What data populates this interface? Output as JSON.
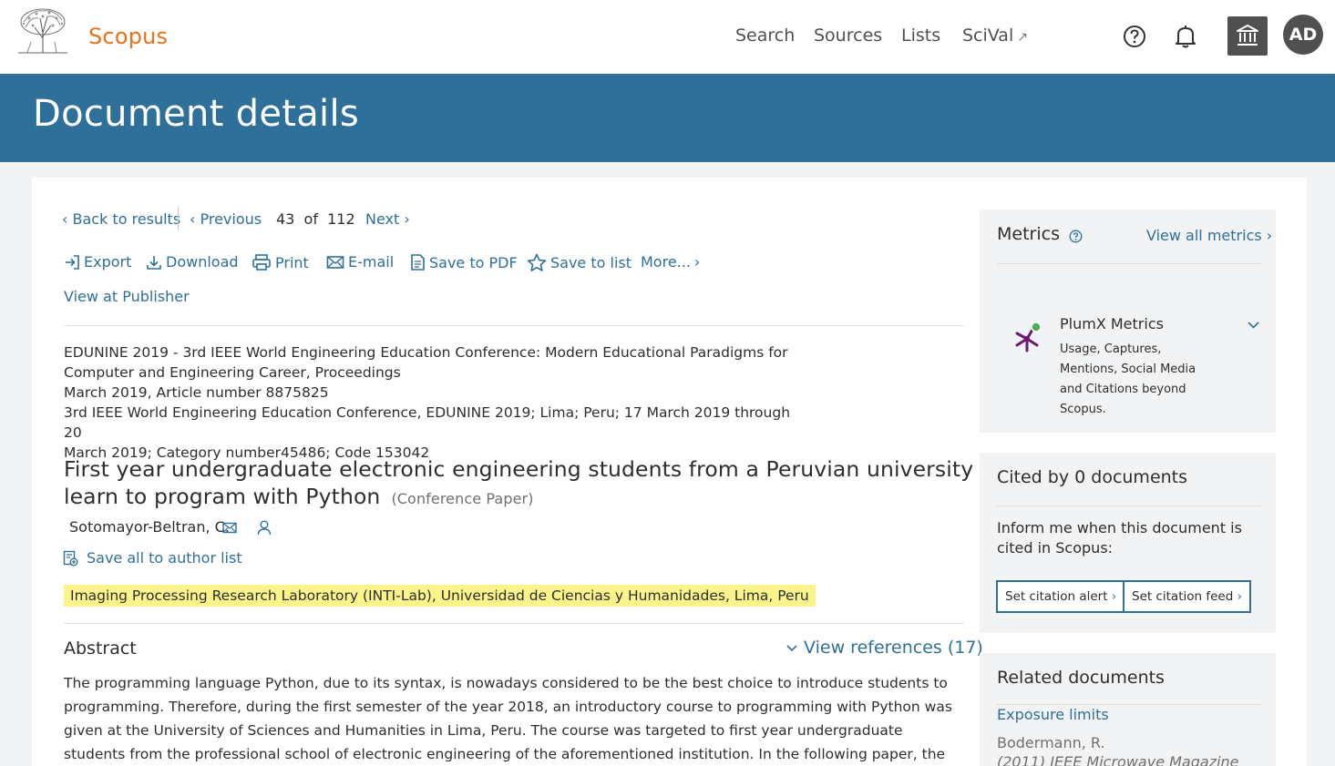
{
  "header": {
    "brand": "Scopus",
    "nav": [
      "Search",
      "Sources",
      "Lists",
      "SciVal"
    ],
    "scival_icon": "external-arrow-icon",
    "avatar": "AD",
    "icons": [
      "help-circle-icon",
      "bell-icon",
      "institution-icon"
    ]
  },
  "banner": {
    "title": "Document details"
  },
  "navigation": {
    "back": "Back to results",
    "previous": "Previous",
    "current": "43",
    "of": "of",
    "total": "112",
    "next": "Next"
  },
  "actions": {
    "export": "Export",
    "download": "Download",
    "print": "Print",
    "email": "E-mail",
    "save_pdf": "Save to PDF",
    "save_list": "Save to list",
    "more": "More...",
    "publisher": "View at Publisher"
  },
  "document": {
    "source_line1": "EDUNINE 2019 - 3rd IEEE World Engineering Education Conference: Modern Educational Paradigms for",
    "source_line2": "Computer and Engineering Career, Proceedings",
    "source_line3": "March 2019, Article number 8875825",
    "source_line4": "3rd IEEE World Engineering Education Conference, EDUNINE 2019; Lima; Peru; 17 March 2019 through 20",
    "source_line5": "March 2019; Category number45486; Code 153042",
    "title": "First year undergraduate electronic engineering students from a Peruvian university learn to program with Python",
    "type": "(Conference Paper)",
    "author": "Sotomayor-Beltran, C.",
    "save_author": "Save all to author list",
    "affiliation": "Imaging Processing Research Laboratory (INTI-Lab), Universidad de Ciencias y Humanidades, Lima, Peru",
    "abstract_heading": "Abstract",
    "view_references": "View references (17)",
    "abstract": "The programming language Python, due to its syntax, is nowadays considered to be the best choice to introduce students to programming. Therefore, during the first semester of the year 2018, an introductory course to programming with Python was given at the University of Sciences and Humanities in Lima, Peru. The course was targeted to first year undergraduate students from the professional school of electronic engineering of the aforementioned institution. In the following paper, the design and methods followed and used,"
  },
  "metrics": {
    "heading": "Metrics",
    "view_all": "View all metrics",
    "plumx_title": "PlumX Metrics",
    "plumx_desc": "Usage, Captures, Mentions, Social Media and Citations beyond Scopus."
  },
  "cited": {
    "heading": "Cited by 0 documents",
    "text": "Inform me when this document is cited in Scopus:",
    "alert_btn": "Set citation alert",
    "feed_btn": "Set citation feed"
  },
  "related": {
    "heading": "Related documents",
    "link": "Exposure limits",
    "author": "Bodermann, R.",
    "source": "(2011) IEEE Microwave Magazine"
  },
  "colors": {
    "brand_orange": "#e9711c",
    "banner_blue": "#2e7099",
    "link_blue": "#2e7099",
    "highlight": "#fbf48a"
  }
}
